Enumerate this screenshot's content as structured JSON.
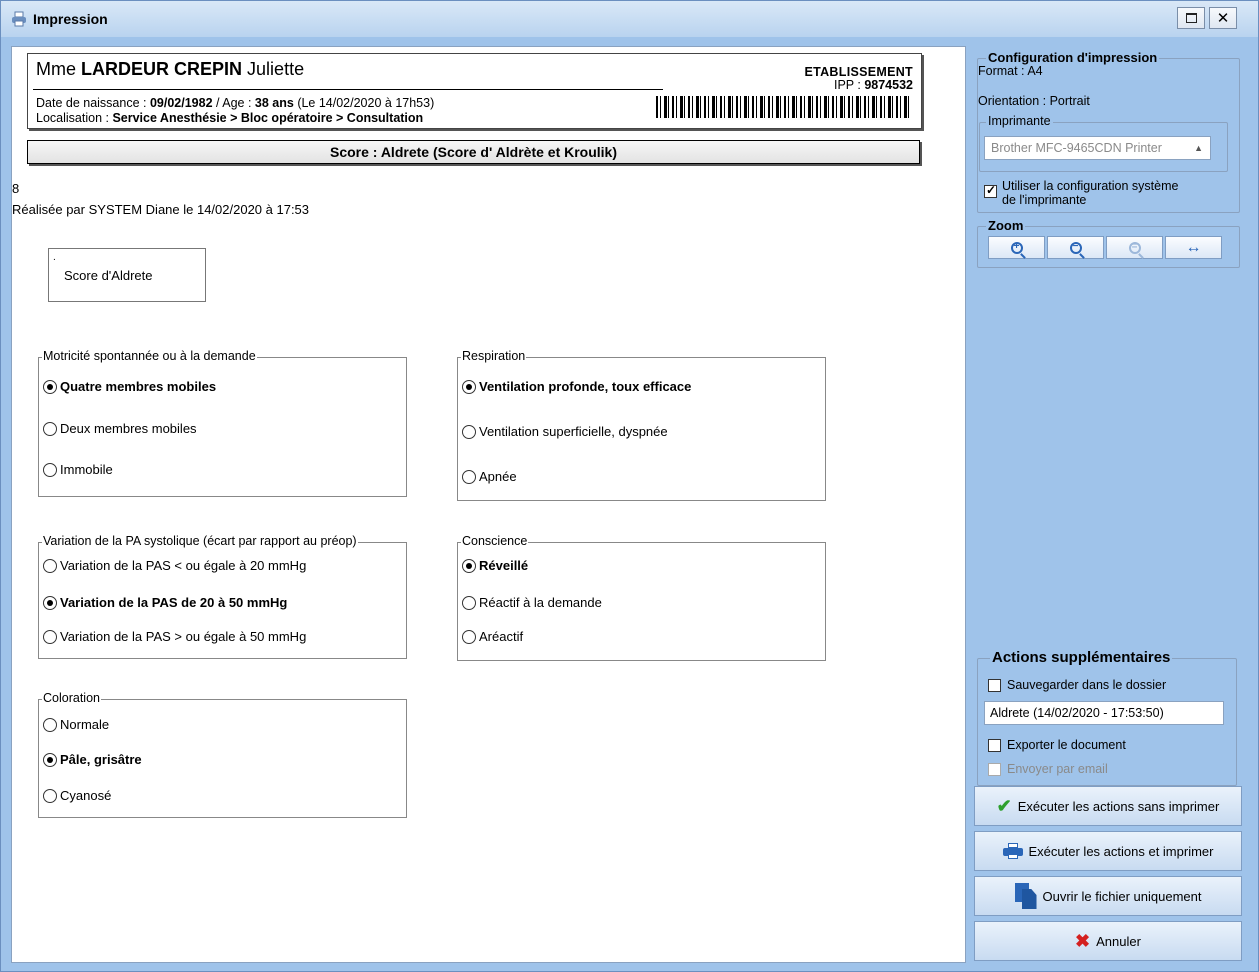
{
  "window": {
    "title": "Impression",
    "minimize_label": "□",
    "close_label": "✕"
  },
  "patient": {
    "civility": "Mme",
    "surname": "LARDEUR CREPIN",
    "firstname": "Juliette",
    "dob_label": "Date de naissance : ",
    "dob": "09/02/1982",
    "age_sep": " / Age : ",
    "age": "38 ans",
    "age_note": " (Le 14/02/2020 à 17h53)",
    "loc_label": "Localisation : ",
    "location": "Service Anesthésie > Bloc opératoire > Consultation",
    "establishment": "ETABLISSEMENT",
    "ipp_label": "IPP : ",
    "ipp": "9874532"
  },
  "score": {
    "header": "Score : Aldrete (Score d' Aldrète et Kroulik)",
    "value": "8",
    "performed_by": "Réalisée par SYSTEM Diane le 14/02/2020 à 17:53",
    "box_label": "Score d'Aldrete",
    "box_dot": "."
  },
  "groups": {
    "motricite": {
      "legend": "Motricité spontannée ou à la demande",
      "options": [
        "Quatre membres mobiles",
        "Deux membres mobiles",
        "Immobile"
      ],
      "selected_index": 0
    },
    "respiration": {
      "legend": "Respiration",
      "options": [
        "Ventilation profonde, toux efficace",
        "Ventilation superficielle, dyspnée",
        "Apnée"
      ],
      "selected_index": 0
    },
    "pa": {
      "legend": "Variation de la PA systolique (écart par rapport au préop)",
      "options": [
        "Variation de la PAS < ou égale à 20 mmHg",
        "Variation de la PAS de 20 à 50 mmHg",
        "Variation de la PAS > ou égale à 50 mmHg"
      ],
      "selected_index": 1
    },
    "conscience": {
      "legend": "Conscience",
      "options": [
        "Réveillé",
        "Réactif à la demande",
        "Aréactif"
      ],
      "selected_index": 0
    },
    "coloration": {
      "legend": "Coloration",
      "options": [
        "Normale",
        "Pâle, grisâtre",
        "Cyanosé"
      ],
      "selected_index": 1
    }
  },
  "print_config": {
    "legend": "Configuration d'impression",
    "format": "Format : A4",
    "orientation": "Orientation : Portrait",
    "printer_legend": "Imprimante",
    "printer": "Brother MFC-9465CDN Printer",
    "use_system_config_line1": "Utiliser la configuration système",
    "use_system_config_line2": "de l'imprimante",
    "use_system_config_checked": true
  },
  "zoom": {
    "legend": "Zoom",
    "buttons": [
      "zoom-in-icon",
      "zoom-out-icon",
      "zoom-reset-icon",
      "fit-width-icon"
    ]
  },
  "actions": {
    "legend": "Actions supplémentaires",
    "save_in_folder": "Sauvegarder dans le dossier",
    "filename": "Aldrete (14/02/2020 - 17:53:50)",
    "export_document": "Exporter le document",
    "send_email": "Envoyer par email",
    "run_no_print": "Exécuter les actions sans imprimer",
    "run_and_print": "Exécuter les actions et imprimer",
    "open_file_only": "Ouvrir le fichier uniquement",
    "cancel": "Annuler"
  },
  "colors": {
    "window_bg": "#9fc3ea",
    "accent_blue": "#2a66b8",
    "check_green": "#2ea02e",
    "cancel_red": "#d42020"
  }
}
